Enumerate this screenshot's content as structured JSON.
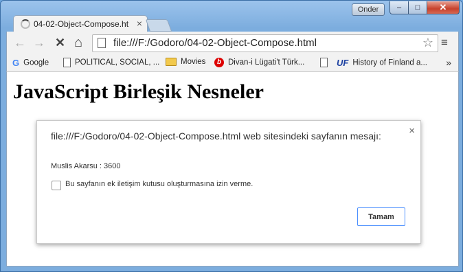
{
  "window": {
    "user_label": "Onder",
    "minimize_glyph": "–",
    "maximize_glyph": "□",
    "close_glyph": "✕"
  },
  "tab": {
    "title": "04-02-Object-Compose.ht",
    "close_glyph": "×"
  },
  "toolbar": {
    "back_glyph": "←",
    "forward_glyph": "→",
    "stop_glyph": "✕",
    "home_glyph": "⌂",
    "url": "file:///F:/Godoro/04-02-Object-Compose.html",
    "star_glyph": "☆",
    "menu_glyph": "≡"
  },
  "bookmarks": {
    "items": [
      {
        "label": "Google",
        "icon": "google-icon"
      },
      {
        "label": "POLITICAL, SOCIAL, ...",
        "icon": "page-icon"
      },
      {
        "label": "Movies",
        "icon": "folder-icon"
      },
      {
        "label": "Divan-i Lügati't Türk...",
        "icon": "red-site-icon"
      },
      {
        "label": "",
        "icon": "page-icon"
      },
      {
        "label": "History of Finland a...",
        "icon": "uf-icon"
      }
    ],
    "more_glyph": "»"
  },
  "page": {
    "heading": "JavaScript Birleşik Nesneler"
  },
  "dialog": {
    "title": "file:///F:/Godoro/04-02-Object-Compose.html web sitesindeki sayfanın mesajı:",
    "close_glyph": "×",
    "message": "Muslis Akarsu : 3600",
    "checkbox_label": "Bu sayfanın ek iletişim kutusu oluşturmasına izin verme.",
    "checkbox_checked": false,
    "ok_label": "Tamam"
  }
}
